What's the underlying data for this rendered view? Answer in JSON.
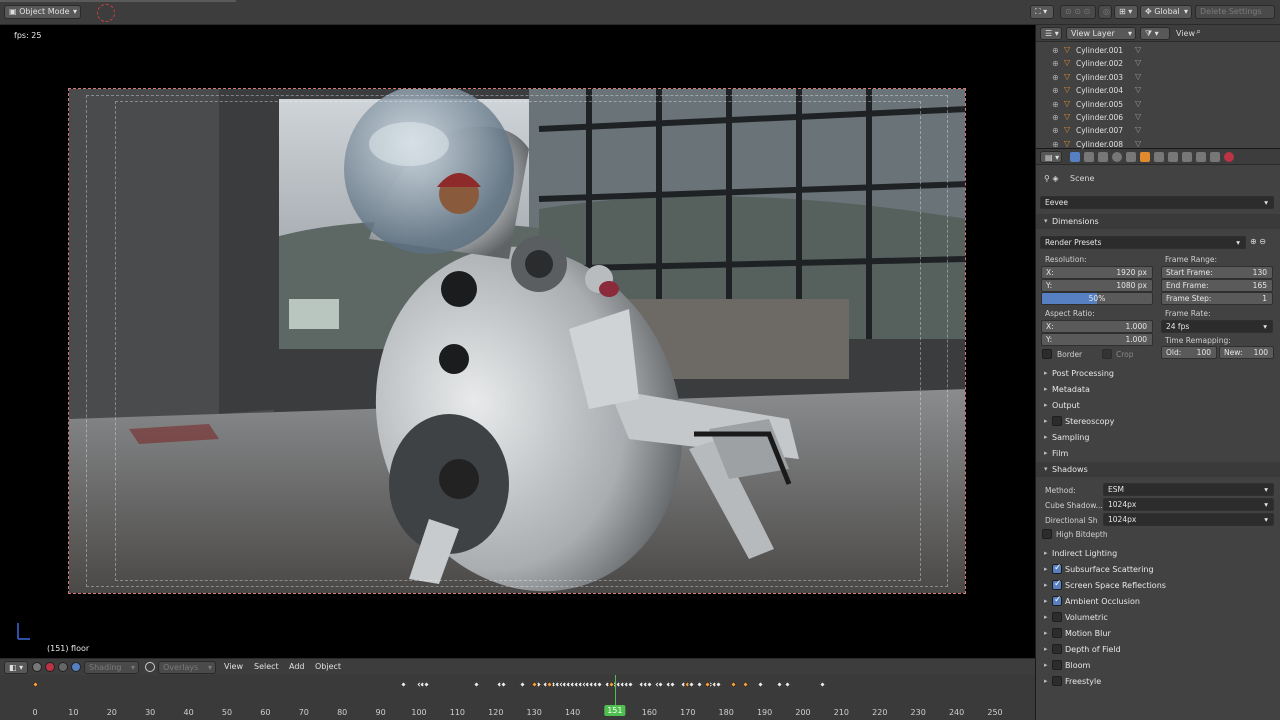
{
  "header": {
    "mode": "Object Mode",
    "orientation": "Global",
    "delete_settings": "Delete Settings"
  },
  "viewport": {
    "fps_text": "fps: 25",
    "object_text": "(151) floor"
  },
  "vp_header": {
    "shading": "Shading",
    "overlays": "Overlays",
    "menus": [
      "View",
      "Select",
      "Add",
      "Object"
    ]
  },
  "timeline": {
    "ticks": [
      "0",
      "10",
      "20",
      "30",
      "40",
      "50",
      "60",
      "70",
      "80",
      "90",
      "100",
      "110",
      "120",
      "130",
      "140",
      "150",
      "160",
      "170",
      "180",
      "190",
      "200",
      "210",
      "220",
      "230",
      "240",
      "250"
    ],
    "current": "151",
    "keyframes": [
      0,
      96,
      100,
      101,
      102,
      115,
      121,
      122,
      127,
      131,
      133,
      135,
      136,
      137,
      138,
      139,
      140,
      141,
      142,
      143,
      144,
      145,
      146,
      147,
      149,
      151,
      152,
      153,
      154,
      155,
      158,
      159,
      160,
      162,
      163,
      165,
      166,
      169,
      170,
      171,
      173,
      176,
      177,
      178,
      182,
      185,
      189,
      194,
      196,
      205
    ],
    "selected_keyframes": [
      0,
      130,
      134,
      150,
      170,
      175,
      182,
      185
    ]
  },
  "outliner": {
    "view_layer": "View Layer",
    "view": "View",
    "items": [
      "Cylinder.001",
      "Cylinder.002",
      "Cylinder.003",
      "Cylinder.004",
      "Cylinder.005",
      "Cylinder.006",
      "Cylinder.007",
      "Cylinder.008"
    ]
  },
  "properties": {
    "scene": "Scene",
    "engine": "Eevee",
    "dimensions": "Dimensions",
    "render_presets": "Render Presets",
    "resolution_label": "Resolution:",
    "res_x_label": "X:",
    "res_x": "1920 px",
    "res_y_label": "Y:",
    "res_y": "1080 px",
    "res_pct": "50%",
    "res_pct_value": 0.5,
    "aspect_label": "Aspect Ratio:",
    "aspect_x_label": "X:",
    "aspect_x": "1.000",
    "aspect_y_label": "Y:",
    "aspect_y": "1.000",
    "border": "Border",
    "crop": "Crop",
    "frame_range_label": "Frame Range:",
    "start_frame_label": "Start Frame:",
    "start_frame": "130",
    "end_frame_label": "End Frame:",
    "end_frame": "165",
    "frame_step_label": "Frame Step:",
    "frame_step": "1",
    "frame_rate_label": "Frame Rate:",
    "frame_rate": "24 fps",
    "time_remap_label": "Time Remapping:",
    "old_label": "Old:",
    "old": "100",
    "new_label": "New:",
    "new": "100",
    "sections_a": [
      "Post Processing",
      "Metadata",
      "Output"
    ],
    "stereoscopy": "Stereoscopy",
    "sections_b": [
      "Sampling",
      "Film"
    ],
    "shadows": "Shadows",
    "method_label": "Method:",
    "method": "ESM",
    "cube_label": "Cube Shadow...",
    "cube": "1024px",
    "dir_label": "Directional Sh",
    "dir": "1024px",
    "high_bitdepth": "High Bitdepth",
    "indirect": "Indirect Lighting",
    "toggles": [
      {
        "label": "Subsurface Scattering",
        "on": true
      },
      {
        "label": "Screen Space Reflections",
        "on": true
      },
      {
        "label": "Ambient Occlusion",
        "on": true
      },
      {
        "label": "Volumetric",
        "on": false
      },
      {
        "label": "Motion Blur",
        "on": false
      },
      {
        "label": "Depth of Field",
        "on": false
      },
      {
        "label": "Bloom",
        "on": false
      },
      {
        "label": "Freestyle",
        "on": false
      }
    ]
  },
  "colors": {
    "accent_blue": "#5680c2",
    "current_frame": "#4fbf4f",
    "keyframe_selected": "#f0a040"
  }
}
